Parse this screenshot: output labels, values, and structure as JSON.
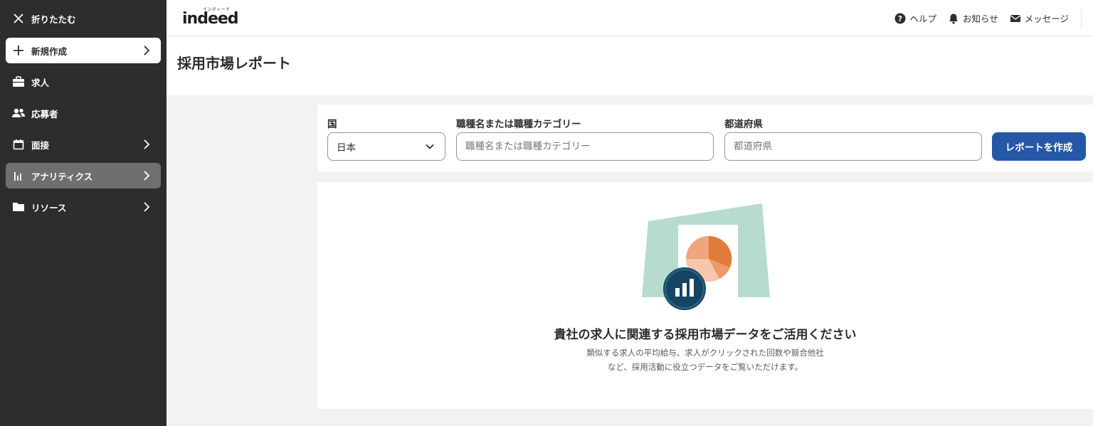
{
  "sidebar": {
    "collapse_label": "折りたたむ",
    "new_label": "新規作成",
    "items": [
      {
        "label": "求人"
      },
      {
        "label": "応募者"
      },
      {
        "label": "面接"
      },
      {
        "label": "アナリティクス"
      },
      {
        "label": "リソース"
      }
    ]
  },
  "header": {
    "logo_text": "indeed",
    "logo_kana": "インディード",
    "help_label": "ヘルプ",
    "notifications_label": "お知らせ",
    "messages_label": "メッセージ"
  },
  "page": {
    "title": "採用市場レポート"
  },
  "filters": {
    "country_label": "国",
    "country_value": "日本",
    "job_label": "職種名または職種カテゴリー",
    "job_placeholder": "職種名または職種カテゴリー",
    "prefecture_label": "都道府県",
    "prefecture_placeholder": "都道府県",
    "create_button": "レポートを作成"
  },
  "empty_state": {
    "title": "貴社の求人に関連する採用市場データをご活用ください",
    "desc_line1": "類似する求人の平均給与、求人がクリックされた回数や競合他社",
    "desc_line2": "など、採用活動に役立つデータをご覧いただけます。"
  },
  "colors": {
    "sidebar_bg": "#2d2d2d",
    "sidebar_active": "#6f6f6f",
    "primary_button": "#2557a7",
    "illustration_green": "#b7dccd",
    "illustration_orange": "#e07b39",
    "badge_navy": "#164463"
  }
}
